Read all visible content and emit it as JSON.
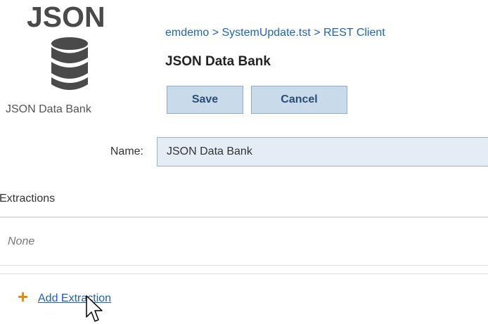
{
  "icon_panel": {
    "title": "JSON",
    "icon": "database-icon",
    "caption": "JSON Data Bank"
  },
  "header": {
    "breadcrumb": "emdemo > SystemUpdate.tst > REST Client",
    "title": "JSON Data Bank"
  },
  "toolbar": {
    "save_label": "Save",
    "cancel_label": "Cancel"
  },
  "form": {
    "name_label": "Name:",
    "name_value": "JSON Data Bank"
  },
  "extractions": {
    "heading": "Extractions",
    "empty_text": "None",
    "add_plus": "+",
    "add_label": "Add Extraction"
  },
  "colors": {
    "link": "#1f63b5",
    "button_bg": "#c9daea",
    "input_bg": "#e4edf6",
    "accent_plus": "#e8850c"
  }
}
